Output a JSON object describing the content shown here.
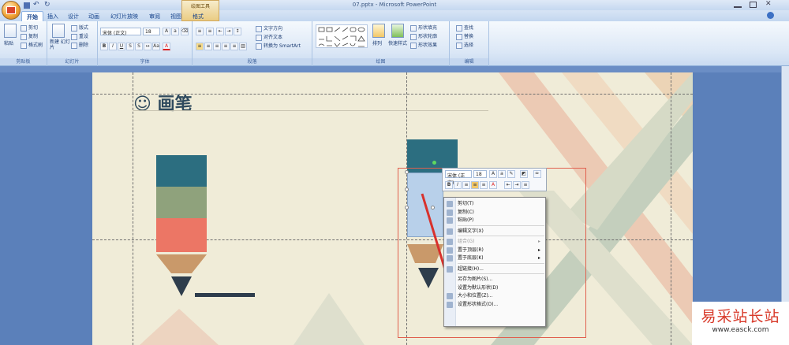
{
  "app": {
    "title": "07.pptx - Microsoft PowerPoint",
    "contextual_tool": "绘图工具"
  },
  "qat": {
    "undo": "↶",
    "redo": "↻"
  },
  "tabs": [
    {
      "label": "开始",
      "active": true
    },
    {
      "label": "插入"
    },
    {
      "label": "设计"
    },
    {
      "label": "动画"
    },
    {
      "label": "幻灯片放映"
    },
    {
      "label": "审阅"
    },
    {
      "label": "视图"
    },
    {
      "label": "格式"
    }
  ],
  "ribbon": {
    "clipboard": {
      "label": "剪贴板",
      "paste": "粘贴",
      "cut": "剪切",
      "copy": "复制",
      "format_painter": "格式刷"
    },
    "slides": {
      "label": "幻灯片",
      "new_slide": "新建 幻灯片",
      "layout": "版式",
      "reset": "重设",
      "delete": "删除"
    },
    "font": {
      "label": "字体",
      "font_name": "宋体 (正文)",
      "font_size": "18"
    },
    "paragraph": {
      "label": "段落",
      "text_direction": "文字方向",
      "align_text": "对齐文本",
      "smartart": "转换为 SmartArt"
    },
    "drawing": {
      "label": "绘图",
      "arrange": "排列",
      "quick_styles": "快速样式",
      "shape_fill": "形状填充",
      "shape_outline": "形状轮廓",
      "shape_effects": "形状效果"
    },
    "editing": {
      "label": "编辑",
      "find": "查找",
      "replace": "替换",
      "select": "选择"
    }
  },
  "slide": {
    "title_icon": "☺",
    "title": "画笔"
  },
  "minitoolbar": {
    "font": "宋体 (正文)",
    "size": "18"
  },
  "context_menu": [
    {
      "label": "剪切(T)",
      "enabled": true,
      "icon": "cut-icon"
    },
    {
      "label": "复制(C)",
      "enabled": true,
      "icon": "copy-icon"
    },
    {
      "label": "粘贴(P)",
      "enabled": true,
      "icon": "paste-icon"
    },
    {
      "sep": true
    },
    {
      "label": "编辑文字(X)",
      "enabled": true,
      "icon": "edit-text-icon"
    },
    {
      "sep": true
    },
    {
      "label": "组合(G)",
      "enabled": false,
      "submenu": true,
      "icon": "group-icon"
    },
    {
      "label": "置于顶层(R)",
      "enabled": true,
      "submenu": true,
      "icon": "bring-front-icon"
    },
    {
      "label": "置于底层(K)",
      "enabled": true,
      "submenu": true,
      "icon": "send-back-icon"
    },
    {
      "sep": true
    },
    {
      "label": "超链接(H)...",
      "enabled": true,
      "icon": "hyperlink-icon"
    },
    {
      "sep": true
    },
    {
      "label": "另存为图片(S)...",
      "enabled": true,
      "icon": ""
    },
    {
      "label": "设置为默认形状(D)",
      "enabled": true,
      "icon": ""
    },
    {
      "label": "大小和位置(Z)...",
      "enabled": true,
      "icon": "size-icon"
    },
    {
      "label": "设置形状格式(O)...",
      "enabled": true,
      "icon": "format-shape-icon"
    }
  ],
  "watermark": {
    "text": "易采站长站",
    "url": "www.easck.com"
  }
}
